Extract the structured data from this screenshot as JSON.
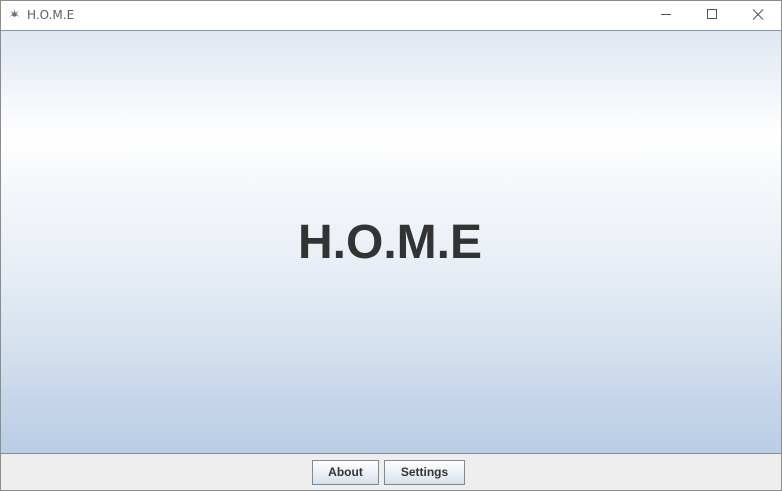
{
  "window": {
    "title": "H.O.M.E",
    "controls": {
      "minimize_icon": "minimize-icon",
      "maximize_icon": "maximize-icon",
      "close_icon": "close-icon"
    }
  },
  "main": {
    "heading": "H.O.M.E"
  },
  "footer": {
    "about_label": "About",
    "settings_label": "Settings"
  },
  "colors": {
    "heading_text": "#333333",
    "gradient_top": "#dfe7f2",
    "gradient_bottom": "#b9cde5",
    "footer_bg": "#eeeeee"
  }
}
